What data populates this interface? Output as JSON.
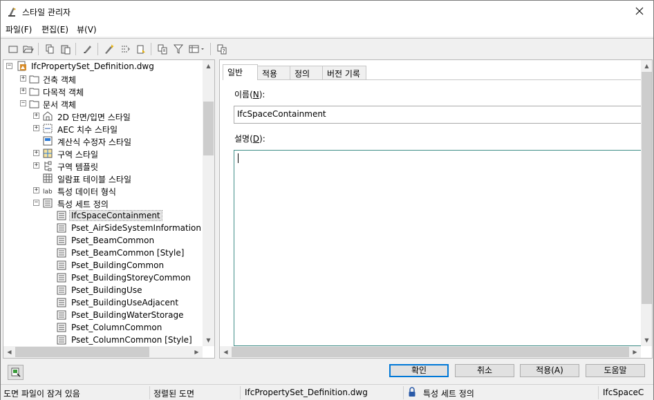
{
  "window": {
    "title": "스타일 관리자"
  },
  "menu": [
    "파일(F)",
    "편집(E)",
    "뷰(V)"
  ],
  "toolbar": {
    "buttons": [
      "new-drawing-icon",
      "open-drawing-icon",
      "copy-icon",
      "paste-icon",
      "edit-style-icon",
      "purge-icon",
      "sort-icon",
      "toggle-icon",
      "filter-icon",
      "view-options-icon",
      "help-icon"
    ]
  },
  "tree": {
    "items": [
      {
        "label": "IfcPropertySet_Definition.dwg",
        "level": 0,
        "expander": "−",
        "icon": "dwg-file-icon"
      },
      {
        "label": "건축 객체",
        "level": 1,
        "expander": "+",
        "icon": "folder-icon"
      },
      {
        "label": "다목적 객체",
        "level": 1,
        "expander": "+",
        "icon": "folder-icon"
      },
      {
        "label": "문서 객체",
        "level": 1,
        "expander": "−",
        "icon": "folder-icon"
      },
      {
        "label": "2D 단면/입면 스타일",
        "level": 2,
        "expander": "+",
        "icon": "section-elevation-icon"
      },
      {
        "label": "AEC 치수 스타일",
        "level": 2,
        "expander": "+",
        "icon": "dimension-icon"
      },
      {
        "label": "계산식 수정자 스타일",
        "level": 2,
        "expander": "",
        "icon": "calculation-icon"
      },
      {
        "label": "구역 스타일",
        "level": 2,
        "expander": "+",
        "icon": "zone-style-icon"
      },
      {
        "label": "구역 템플릿",
        "level": 2,
        "expander": "+",
        "icon": "zone-template-icon"
      },
      {
        "label": "일람표 테이블 스타일",
        "level": 2,
        "expander": "",
        "icon": "schedule-table-icon"
      },
      {
        "label": "특성 데이터 형식",
        "level": 2,
        "expander": "+",
        "icon": "data-format-icon"
      },
      {
        "label": "특성 세트 정의",
        "level": 2,
        "expander": "−",
        "icon": "property-set-icon"
      },
      {
        "label": "IfcSpaceContainment",
        "level": 3,
        "expander": "",
        "icon": "property-set-item-icon",
        "selected": true
      },
      {
        "label": "Pset_AirSideSystemInformation",
        "level": 3,
        "expander": "",
        "icon": "property-set-item-icon"
      },
      {
        "label": "Pset_BeamCommon",
        "level": 3,
        "expander": "",
        "icon": "property-set-item-icon"
      },
      {
        "label": "Pset_BeamCommon [Style]",
        "level": 3,
        "expander": "",
        "icon": "property-set-item-icon"
      },
      {
        "label": "Pset_BuildingCommon",
        "level": 3,
        "expander": "",
        "icon": "property-set-item-icon"
      },
      {
        "label": "Pset_BuildingStoreyCommon",
        "level": 3,
        "expander": "",
        "icon": "property-set-item-icon"
      },
      {
        "label": "Pset_BuildingUse",
        "level": 3,
        "expander": "",
        "icon": "property-set-item-icon"
      },
      {
        "label": "Pset_BuildingUseAdjacent",
        "level": 3,
        "expander": "",
        "icon": "property-set-item-icon"
      },
      {
        "label": "Pset_BuildingWaterStorage",
        "level": 3,
        "expander": "",
        "icon": "property-set-item-icon"
      },
      {
        "label": "Pset_ColumnCommon",
        "level": 3,
        "expander": "",
        "icon": "property-set-item-icon"
      },
      {
        "label": "Pset_ColumnCommon [Style]",
        "level": 3,
        "expander": "",
        "icon": "property-set-item-icon"
      }
    ]
  },
  "tabs": [
    "일반",
    "적용",
    "정의",
    "버전 기록"
  ],
  "general": {
    "name_label": "이름(N):",
    "name_value": "IfcSpaceContainment",
    "description_label": "설명(D):",
    "description_value": ""
  },
  "buttons": {
    "ok": "확인",
    "cancel": "취소",
    "apply": "적용(A)",
    "help": "도움말"
  },
  "status": {
    "lock": "도면 파일이 잠겨 있음",
    "sort": "정렬된 도면",
    "drawing": "IfcPropertySet_Definition.dwg",
    "category": "특성 세트 정의",
    "style": "IfcSpaceC"
  }
}
